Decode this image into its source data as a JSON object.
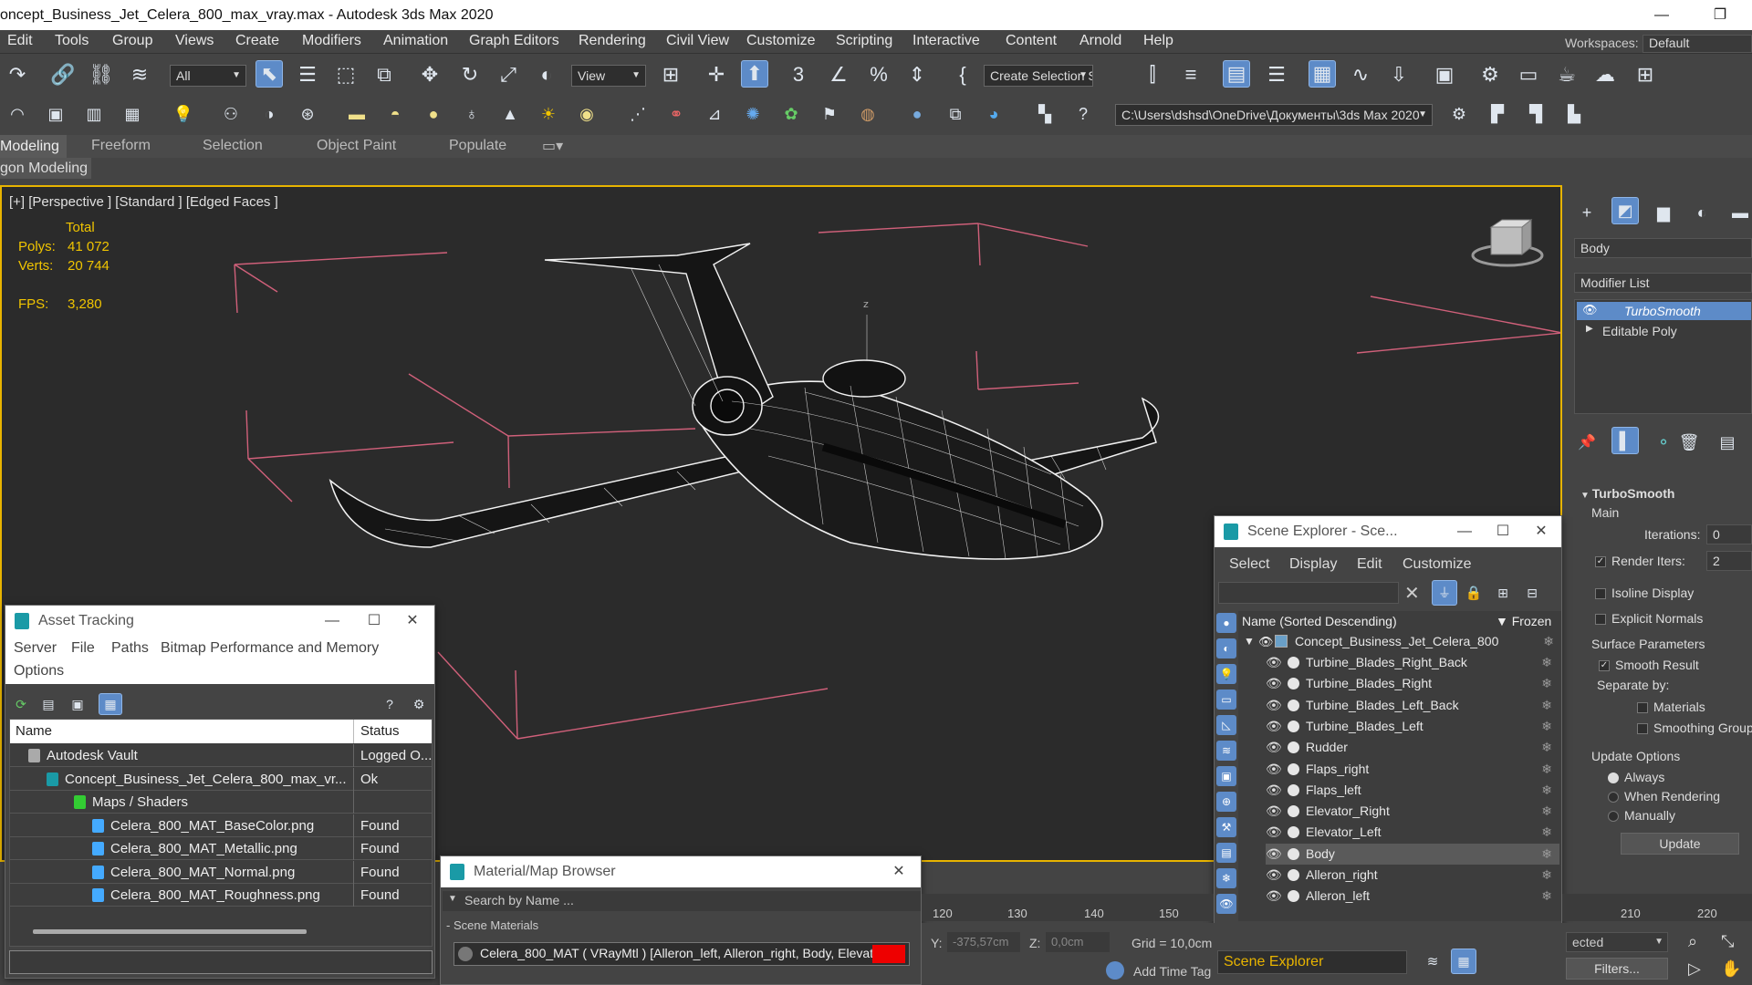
{
  "window": {
    "title": "oncept_Business_Jet_Celera_800_max_vray.max - Autodesk 3ds Max 2020",
    "minimize": "—",
    "restore": "❐"
  },
  "menu": [
    "Edit",
    "Tools",
    "Group",
    "Views",
    "Create",
    "Modifiers",
    "Animation",
    "Graph Editors",
    "Rendering",
    "Civil View",
    "Customize",
    "Scripting",
    "Interactive",
    "Content",
    "Arnold",
    "Help"
  ],
  "workspaces": {
    "label": "Workspaces:",
    "value": "Default"
  },
  "toolbar": {
    "selection_filter": "All",
    "ref_coord": "View",
    "create_selection_set": "Create Selection Set",
    "project_path": "C:\\Users\\dshsd\\OneDrive\\Документы\\3ds Max 2020"
  },
  "ribbon": {
    "tabs": [
      "Modeling",
      "Freeform",
      "Selection",
      "Object Paint",
      "Populate"
    ],
    "active_tab": "Modeling",
    "sub_label": "gon Modeling"
  },
  "viewport": {
    "label": "[+] [Perspective ] [Standard ] [Edged Faces ]",
    "stats_header": "Total",
    "polys_label": "Polys:",
    "polys_value": "41 072",
    "verts_label": "Verts:",
    "verts_value": "20 744",
    "fps_label": "FPS:",
    "fps_value": "3,280",
    "axis_label": "z"
  },
  "command_panel": {
    "object_name": "Body",
    "modifier_list": "Modifier List",
    "stack": [
      "TurboSmooth",
      "Editable Poly"
    ],
    "rollout_title": "TurboSmooth",
    "main_label": "Main",
    "iterations_label": "Iterations:",
    "iterations_value": "0",
    "render_iters_label": "Render Iters:",
    "render_iters_value": "2",
    "isoline_display": "Isoline Display",
    "explicit_normals": "Explicit Normals",
    "surface_params": "Surface Parameters",
    "smooth_result": "Smooth Result",
    "separate_by": "Separate by:",
    "materials": "Materials",
    "smoothing_groups": "Smoothing Groups",
    "update_options": "Update Options",
    "always": "Always",
    "when_rendering": "When Rendering",
    "manually": "Manually",
    "update_button": "Update"
  },
  "asset_tracking": {
    "title": "Asset Tracking",
    "menu": [
      "Server",
      "File",
      "Paths",
      "Bitmap Performance and Memory",
      "Options"
    ],
    "col_name": "Name",
    "col_status": "Status",
    "rows": [
      {
        "name": "Autodesk Vault",
        "status": "Logged O..."
      },
      {
        "name": "Concept_Business_Jet_Celera_800_max_vr...",
        "status": "Ok"
      },
      {
        "name": "Maps / Shaders",
        "status": ""
      },
      {
        "name": "Celera_800_MAT_BaseColor.png",
        "status": "Found"
      },
      {
        "name": "Celera_800_MAT_Metallic.png",
        "status": "Found"
      },
      {
        "name": "Celera_800_MAT_Normal.png",
        "status": "Found"
      },
      {
        "name": "Celera_800_MAT_Roughness.png",
        "status": "Found"
      }
    ]
  },
  "material_browser": {
    "title": "Material/Map Browser",
    "search_placeholder": "Search by Name ...",
    "section": "- Scene Materials",
    "material_entry": "Celera_800_MAT  ( VRayMtl )  [Alleron_left, Alleron_right, Body, Elevat..."
  },
  "scene_explorer": {
    "title": "Scene Explorer - Sce...",
    "menu": [
      "Select",
      "Display",
      "Edit",
      "Customize"
    ],
    "col_name": "Name (Sorted Descending)",
    "col_frozen": "▼ Frozen",
    "root": "Concept_Business_Jet_Celera_800",
    "items": [
      "Turbine_Blades_Right_Back",
      "Turbine_Blades_Right",
      "Turbine_Blades_Left_Back",
      "Turbine_Blades_Left",
      "Rudder",
      "Flaps_right",
      "Flaps_left",
      "Elevator_Right",
      "Elevator_Left",
      "Body",
      "Alleron_right",
      "Alleron_left"
    ],
    "selected": "Body",
    "footer_label": "Scene Explorer"
  },
  "timeline": {
    "ticks": [
      "120",
      "130",
      "140",
      "150",
      "210",
      "220"
    ]
  },
  "status": {
    "y_label": "Y:",
    "y_value": "-375,57cm",
    "z_label": "Z:",
    "z_value": "0,0cm",
    "grid": "Grid = 10,0cm",
    "add_time_tag": "Add Time Tag",
    "selected_combo": "ected",
    "filters": "Filters..."
  }
}
